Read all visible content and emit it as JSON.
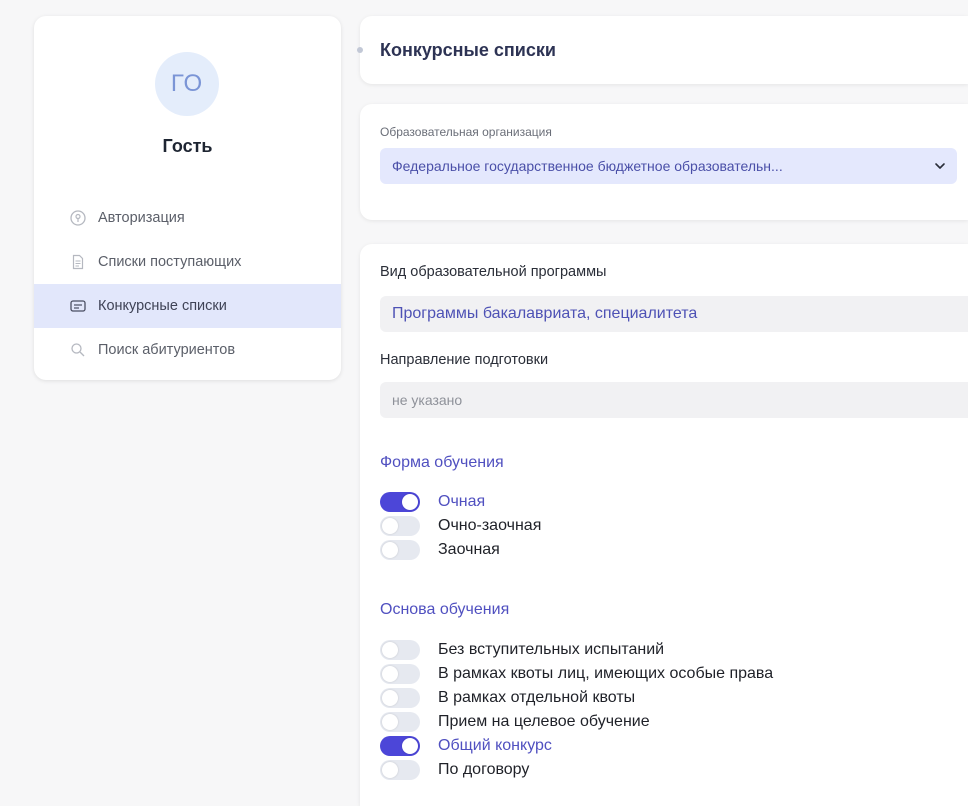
{
  "sidebar": {
    "avatar_initials": "ГО",
    "username": "Гость",
    "items": [
      {
        "label": "Авторизация",
        "icon": "key-circle-icon",
        "active": false
      },
      {
        "label": "Списки поступающих",
        "icon": "document-icon",
        "active": false
      },
      {
        "label": "Конкурсные списки",
        "icon": "id-card-icon",
        "active": true
      },
      {
        "label": "Поиск абитуриентов",
        "icon": "search-icon",
        "active": false
      }
    ]
  },
  "header": {
    "title": "Конкурсные списки"
  },
  "org": {
    "label": "Образовательная организация",
    "selected": "Федеральное государственное бюджетное образовательн..."
  },
  "program": {
    "label": "Вид образовательной программы",
    "value": "Программы бакалавриата, специалитета"
  },
  "direction": {
    "label": "Направление подготовки",
    "placeholder": "не указано"
  },
  "study_form": {
    "title": "Форма обучения",
    "options": [
      {
        "label": "Очная",
        "on": true
      },
      {
        "label": "Очно-заочная",
        "on": false
      },
      {
        "label": "Заочная",
        "on": false
      }
    ]
  },
  "study_basis": {
    "title": "Основа обучения",
    "options": [
      {
        "label": "Без вступительных испытаний",
        "on": false
      },
      {
        "label": "В рамках квоты лиц, имеющих особые права",
        "on": false
      },
      {
        "label": "В рамках отдельной квоты",
        "on": false
      },
      {
        "label": "Прием на целевое обучение",
        "on": false
      },
      {
        "label": "Общий конкурс",
        "on": true
      },
      {
        "label": "По договору",
        "on": false
      }
    ]
  },
  "colors": {
    "accent": "#4c46d8",
    "accent_text": "#5050c0",
    "active_nav_bg": "#e2e7fb",
    "select_bg": "#e4e8fd"
  }
}
